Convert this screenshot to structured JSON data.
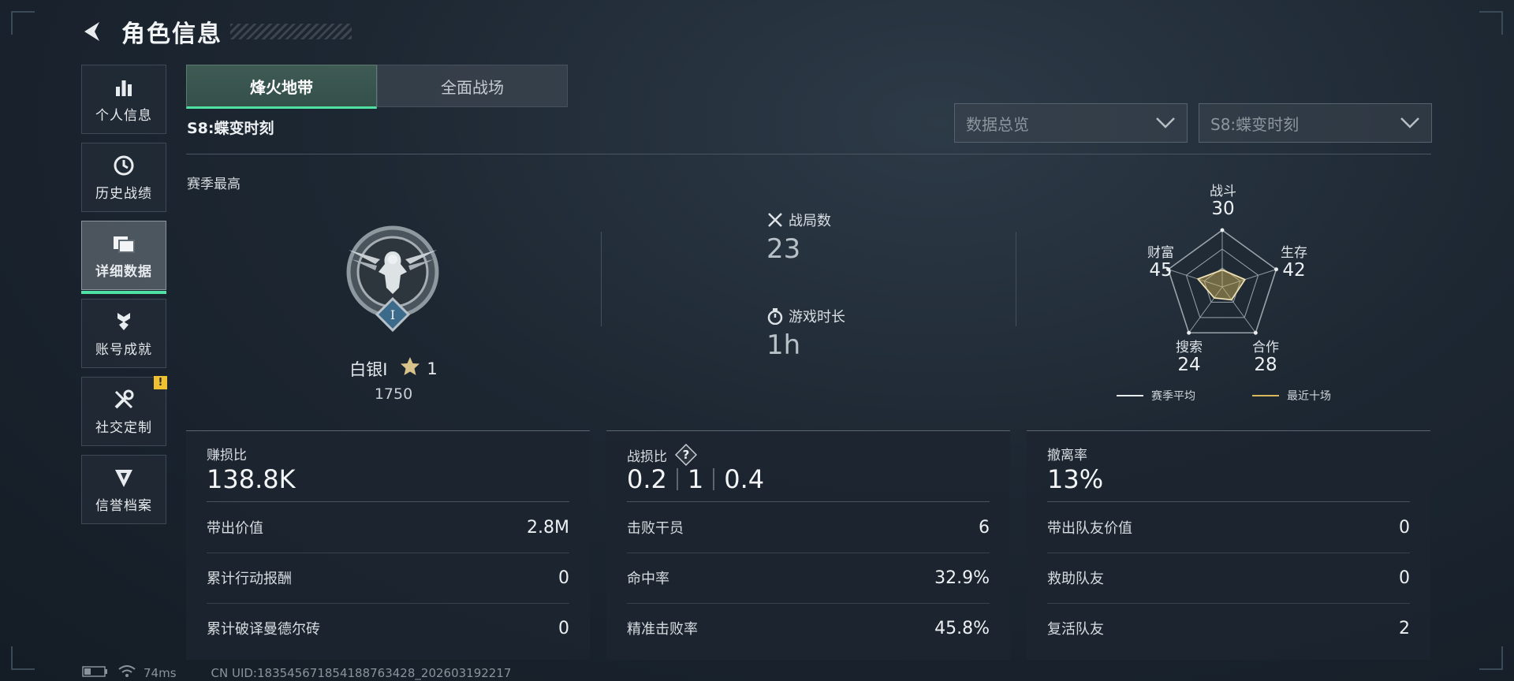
{
  "header": {
    "title": "角色信息"
  },
  "sidebar": {
    "items": [
      {
        "label": "个人信息",
        "icon": "bar-chart-icon",
        "active": false
      },
      {
        "label": "历史战绩",
        "icon": "history-icon",
        "active": false
      },
      {
        "label": "详细数据",
        "icon": "cards-icon",
        "active": true
      },
      {
        "label": "账号成就",
        "icon": "achievement-icon",
        "active": false
      },
      {
        "label": "社交定制",
        "icon": "tools-icon",
        "active": false,
        "badge": "!"
      },
      {
        "label": "信誉档案",
        "icon": "credit-icon",
        "active": false
      }
    ]
  },
  "tabs": [
    {
      "label": "烽火地带",
      "active": true
    },
    {
      "label": "全面战场",
      "active": false
    }
  ],
  "season": {
    "name": "S8:蝶变时刻"
  },
  "filters": {
    "view": "数据总览",
    "season": "S8:蝶变时刻"
  },
  "rank": {
    "section_label": "赛季最高",
    "name": "白银I",
    "stars": "1",
    "score": "1750",
    "emblem_numeral": "I"
  },
  "stats": {
    "matches_label": "战局数",
    "matches_value": "23",
    "playtime_label": "游戏时长",
    "playtime_value": "1h"
  },
  "radar": {
    "axes": [
      {
        "label": "战斗",
        "value": 30
      },
      {
        "label": "生存",
        "value": 42
      },
      {
        "label": "合作",
        "value": 28
      },
      {
        "label": "搜索",
        "value": 24
      },
      {
        "label": "财富",
        "value": 45
      }
    ],
    "legend_avg": "赛季平均",
    "legend_recent": "最近十场",
    "colors": {
      "avg": "#e8ecef",
      "recent": "#d8b85a"
    }
  },
  "cards": {
    "profit": {
      "title": "赚损比",
      "value": "138.8K",
      "rows": [
        {
          "label": "带出价值",
          "value": "2.8M"
        },
        {
          "label": "累计行动报酬",
          "value": "0"
        },
        {
          "label": "累计破译曼德尔砖",
          "value": "0"
        }
      ]
    },
    "combat": {
      "title": "战损比",
      "value_a": "0.2",
      "value_b": "1",
      "value_c": "0.4",
      "rows": [
        {
          "label": "击败干员",
          "value": "6"
        },
        {
          "label": "命中率",
          "value": "32.9%"
        },
        {
          "label": "精准击败率",
          "value": "45.8%"
        }
      ]
    },
    "extract": {
      "title": "撤离率",
      "value": "13%",
      "rows": [
        {
          "label": "带出队友价值",
          "value": "0"
        },
        {
          "label": "救助队友",
          "value": "0"
        },
        {
          "label": "复活队友",
          "value": "2"
        }
      ]
    }
  },
  "statusbar": {
    "ping": "74ms",
    "uid": "CN UID:18354567185418876342​8_202603192217"
  },
  "theme": {
    "accent": "#4fe0a4",
    "warning": "#f0c033"
  }
}
